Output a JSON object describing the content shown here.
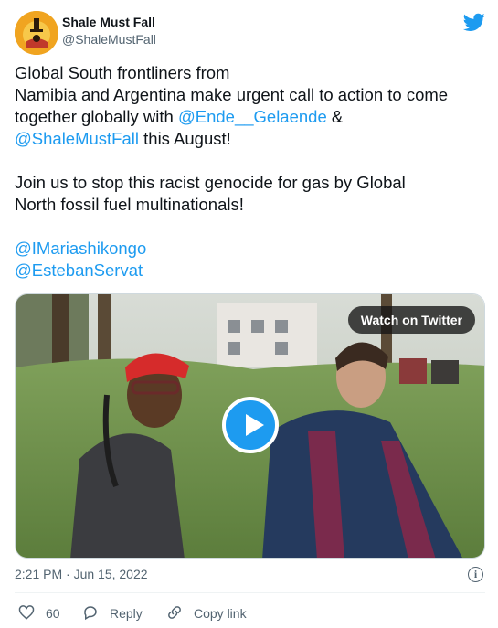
{
  "account": {
    "name": "Shale Must Fall",
    "handle": "@ShaleMustFall"
  },
  "tweet": {
    "line1": "Global South frontliners from",
    "line2": "Namibia and Argentina make urgent call to action to come",
    "line3_pre": "together globally with ",
    "line3_mention": "@Ende__Gelaende",
    "line3_post": " &",
    "line4_mention": "@ShaleMustFall",
    "line4_post": " this August!",
    "para2_line1": "Join us to stop this racist genocide for gas by Global",
    "para2_line2": "North fossil fuel multinationals!",
    "mention_a": "@IMariashikongo",
    "mention_b": "@EstebanServat"
  },
  "media": {
    "watch_label": "Watch on Twitter"
  },
  "meta": {
    "timestamp": "2:21 PM · Jun 15, 2022"
  },
  "actions": {
    "like_count": "60",
    "reply_label": "Reply",
    "copy_label": "Copy link"
  },
  "colors": {
    "accent": "#1d9bf0",
    "text": "#0f1419",
    "muted": "#536471"
  },
  "icons": [
    "twitter-bird-icon",
    "info-icon",
    "heart-icon",
    "reply-icon",
    "link-icon",
    "play-icon"
  ]
}
